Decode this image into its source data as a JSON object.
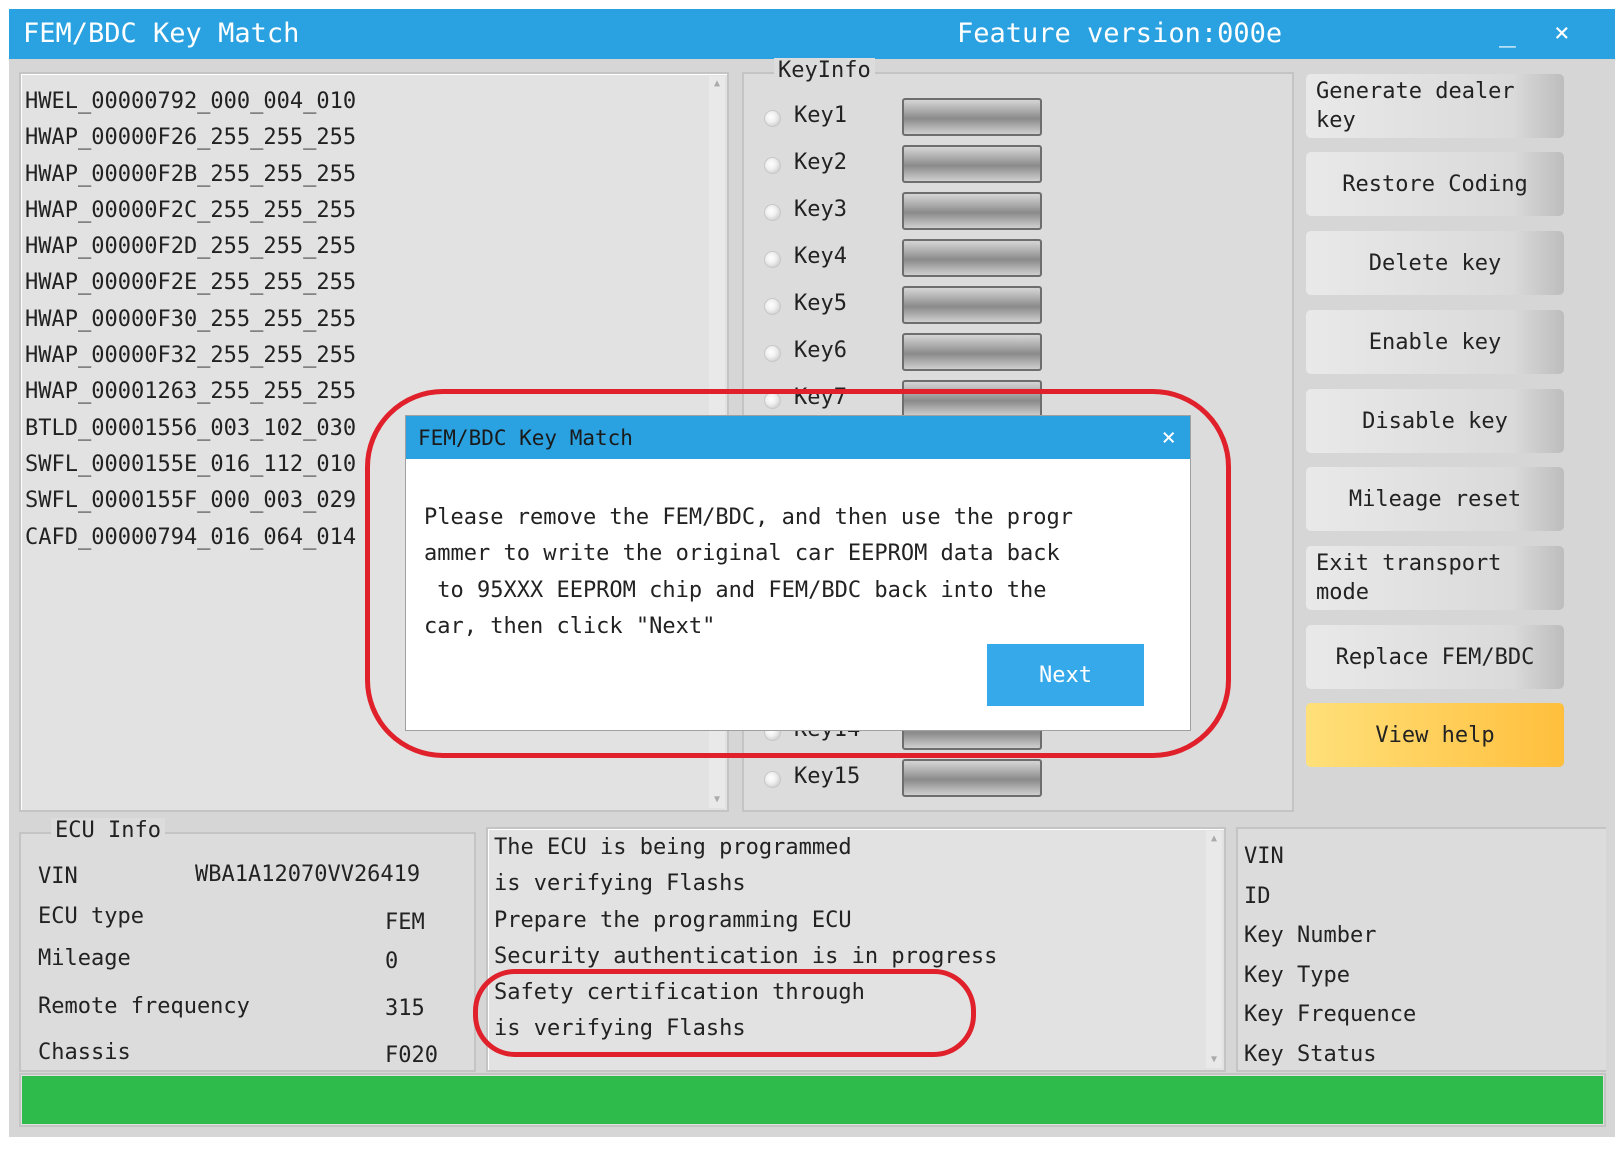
{
  "window": {
    "title": "FEM/BDC Key Match",
    "version": "Feature version:000e",
    "minimize": "_",
    "close": "×"
  },
  "module_list": [
    "HWEL_00000792_000_004_010",
    "HWAP_00000F26_255_255_255",
    "HWAP_00000F2B_255_255_255",
    "HWAP_00000F2C_255_255_255",
    "HWAP_00000F2D_255_255_255",
    "HWAP_00000F2E_255_255_255",
    "HWAP_00000F30_255_255_255",
    "HWAP_00000F32_255_255_255",
    "HWAP_00001263_255_255_255",
    "BTLD_00001556_003_102_030",
    "SWFL_0000155E_016_112_010",
    "SWFL_0000155F_000_003_029",
    "CAFD_00000794_016_064_014"
  ],
  "key_info": {
    "legend": "KeyInfo",
    "keys": [
      "Key1",
      "Key2",
      "Key3",
      "Key4",
      "Key5",
      "Key6",
      "Key7",
      "Key14",
      "Key15"
    ]
  },
  "buttons": {
    "generate_dealer_key": "Generate dealer key",
    "restore_coding": "Restore Coding",
    "delete_key": "Delete key",
    "enable_key": "Enable key",
    "disable_key": "Disable key",
    "mileage_reset": "Mileage reset",
    "exit_transport_mode": "Exit transport mode",
    "replace_fem_bdc": "Replace FEM/BDC",
    "view_help": "View help"
  },
  "ecu_info": {
    "legend": "ECU Info",
    "vin_label": "VIN",
    "vin_value": "WBA1A12070VV26419",
    "ecu_type_label": "ECU type",
    "ecu_type_value": "FEM",
    "mileage_label": "Mileage",
    "mileage_value": "0",
    "remote_frequency_label": "Remote frequency",
    "remote_frequency_value": "315",
    "chassis_label": "Chassis",
    "chassis_value": "F020"
  },
  "log": [
    "The ECU is being programmed",
    "is verifying Flashs",
    "Prepare the programming ECU",
    "Security authentication is in progress",
    "Safety certification through",
    "is verifying Flashs"
  ],
  "key_details": [
    "VIN",
    "ID",
    "Key Number",
    "Key Type",
    "Key Frequence",
    "Key Status"
  ],
  "progress": {
    "fraction": 1.0,
    "color": "#2fba4c"
  },
  "modal": {
    "title": "FEM/BDC Key Match",
    "close": "×",
    "message": "Please remove the FEM/BDC, and then use the progr\nammer to write the original car EEPROM data back\n to 95XXX EEPROM chip and FEM/BDC back into the\ncar, then click \"Next\"",
    "next_label": "Next"
  },
  "colors": {
    "titlebar": "#2aa1e0",
    "next_button": "#36a9ea",
    "help_button": "#ffbf3d",
    "annotation": "#e0202a"
  }
}
